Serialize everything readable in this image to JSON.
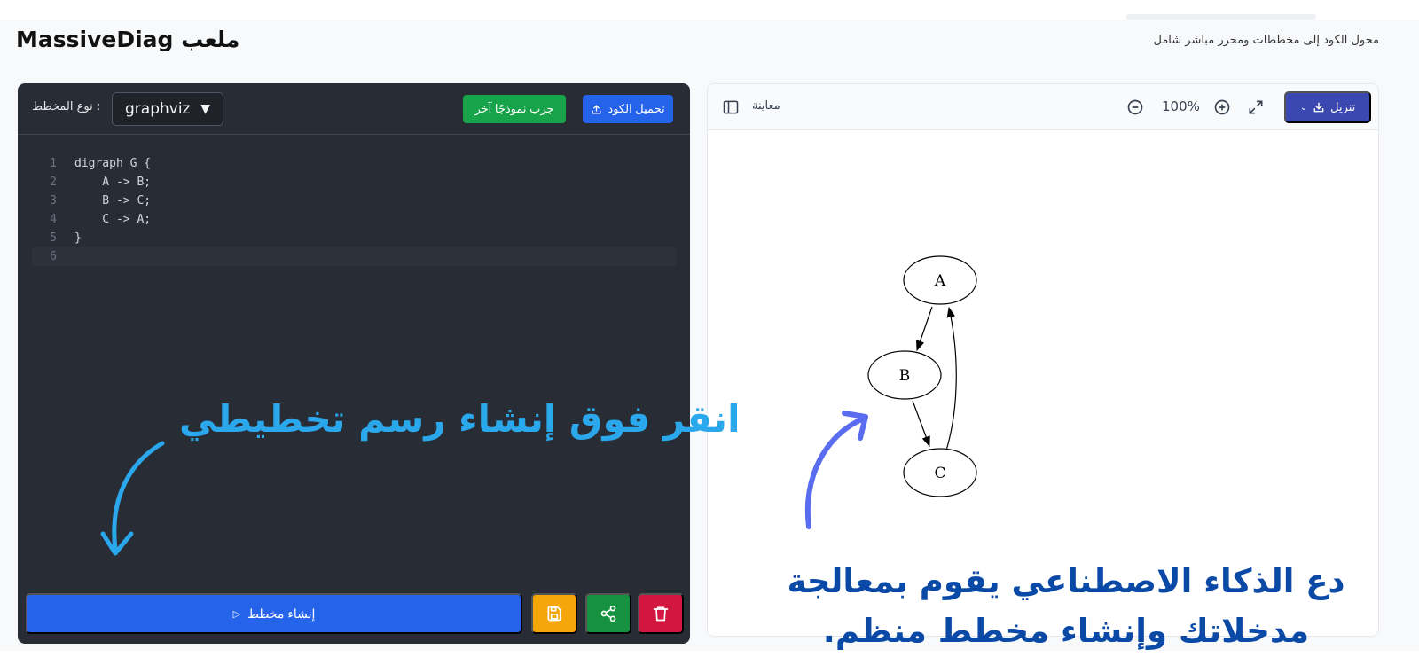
{
  "header": {
    "title": "MassiveDiag ملعب",
    "subtitle": "محول الكود إلى مخططات ومحرر مباشر شامل"
  },
  "editor": {
    "type_label": ": نوع المخطط",
    "type_value": "graphviz",
    "upload_label": "تحميل الكود",
    "example_label": "جرب نموذجًا آخر",
    "lines": [
      {
        "n": "1",
        "text": "digraph G {"
      },
      {
        "n": "2",
        "text": "    A -> B;"
      },
      {
        "n": "3",
        "text": "    B -> C;"
      },
      {
        "n": "4",
        "text": "    C -> A;"
      },
      {
        "n": "5",
        "text": "}"
      },
      {
        "n": "6",
        "text": ""
      }
    ],
    "generate_label": "إنشاء مخطط"
  },
  "preview": {
    "download_label": "تنزيل",
    "zoom": "100%",
    "label": "معاينة",
    "graph": {
      "nodes": [
        "A",
        "B",
        "C"
      ],
      "edges": [
        [
          "A",
          "B"
        ],
        [
          "B",
          "C"
        ],
        [
          "C",
          "A"
        ]
      ]
    }
  },
  "annotations": {
    "click_hint": "انقر فوق إنشاء رسم تخطيطي",
    "ai_hint": "دع الذكاء الاصطناعي يقوم بمعالجة مدخلاتك وإنشاء مخطط منظم."
  },
  "colors": {
    "primary": "#2563eb",
    "success": "#16a34a",
    "warning": "#f5a60b",
    "danger": "#d31640",
    "editor_bg": "#282c34",
    "download": "#3b48b0"
  }
}
